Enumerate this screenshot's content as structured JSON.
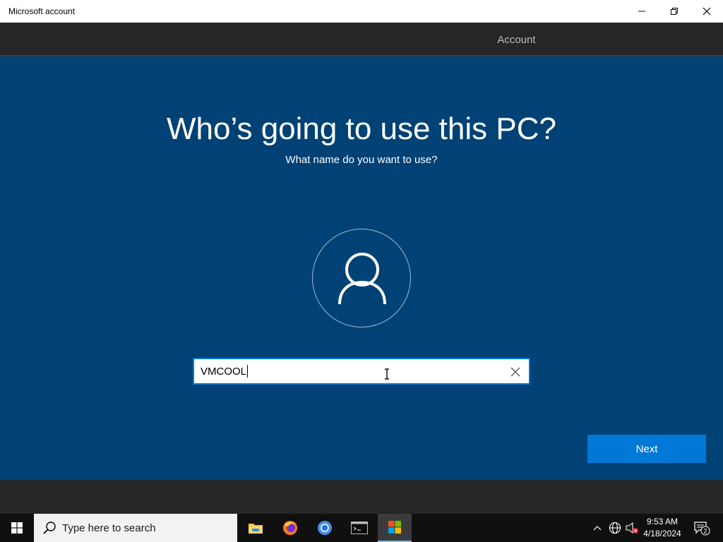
{
  "window": {
    "title": "Microsoft account"
  },
  "header": {
    "tab_label": "Account"
  },
  "main": {
    "heading": "Who’s going to use this PC?",
    "subheading": "What name do you want to use?",
    "name_input_value": "VMCOOL",
    "next_label": "Next"
  },
  "taskbar": {
    "search_placeholder": "Type here to search",
    "apps": [
      "file-explorer",
      "firefox",
      "chrome",
      "terminal",
      "microsoft-store"
    ],
    "clock_time": "9:53 AM",
    "clock_date": "4/18/2024",
    "notification_count": "2"
  },
  "colors": {
    "main_bg": "#004275",
    "accent": "#0078d7",
    "header_bg": "#262626",
    "taskbar_bg": "#101010"
  }
}
